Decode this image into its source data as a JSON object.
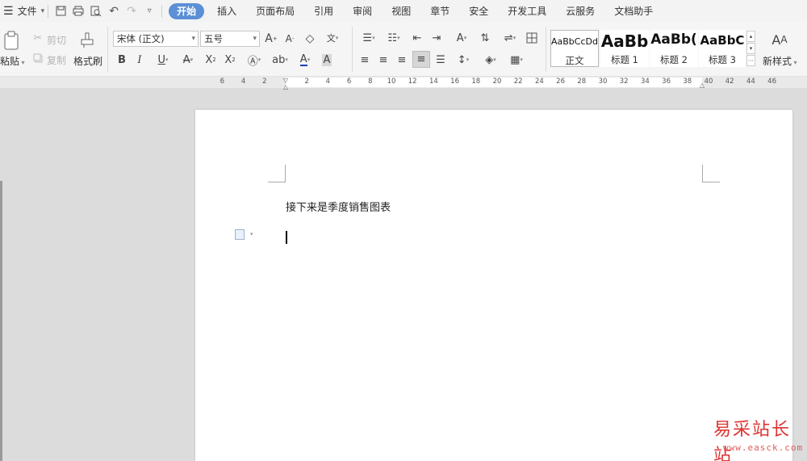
{
  "menubar": {
    "file_label": "文件",
    "tabs": [
      "开始",
      "插入",
      "页面布局",
      "引用",
      "审阅",
      "视图",
      "章节",
      "安全",
      "开发工具",
      "云服务",
      "文档助手"
    ],
    "active_tab": "开始"
  },
  "ribbon": {
    "paste_label": "粘贴",
    "cut_label": "剪切",
    "copy_label": "复制",
    "format_painter_label": "格式刷",
    "font_name": "宋体 (正文)",
    "font_size": "五号",
    "styles": [
      {
        "sample": "AaBbCcDd",
        "name": "正文"
      },
      {
        "sample": "AaBb",
        "name": "标题 1"
      },
      {
        "sample": "AaBb(",
        "name": "标题 2"
      },
      {
        "sample": "AaBbC",
        "name": "标题 3"
      }
    ],
    "new_style_label": "新样式"
  },
  "ruler": {
    "left_numbers": [
      "6",
      "4",
      "2"
    ],
    "right_numbers": [
      "2",
      "4",
      "6",
      "8",
      "10",
      "12",
      "14",
      "16",
      "18",
      "20",
      "22",
      "24",
      "26",
      "28",
      "30",
      "32",
      "34",
      "36",
      "38",
      "40",
      "42",
      "44",
      "46"
    ]
  },
  "document": {
    "text": "接下来是季度销售图表"
  },
  "watermark": {
    "site_name": "易采站长站",
    "url": "www.easck.com"
  },
  "colors": {
    "accent": "#5b8fd6",
    "watermark": "#d33333"
  }
}
